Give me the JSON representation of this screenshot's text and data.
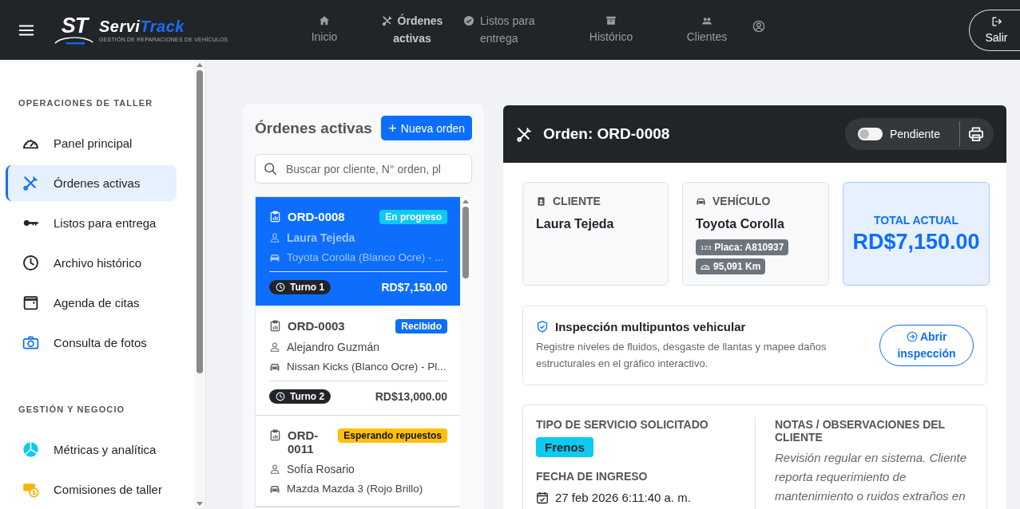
{
  "top_bar": {
    "logo": {
      "mark": "ST",
      "name_start": "Servi",
      "name_end": "Track",
      "tagline": "GESTIÓN DE REPARACIONES DE VEHÍCULOS"
    },
    "nav": [
      {
        "label": "Inicio",
        "selected": false
      },
      {
        "label": "Órdenes activas",
        "selected": true
      },
      {
        "label": "Listos para entrega",
        "selected": false
      },
      {
        "label": "Histórico",
        "selected": false
      },
      {
        "label": "Clientes",
        "selected": false
      }
    ],
    "logout_button": {
      "label": "Salir"
    }
  },
  "sidebar": {
    "sections": [
      {
        "title": "OPERACIONES DE TALLER",
        "items": [
          {
            "label": "Panel principal",
            "selected": false
          },
          {
            "label": "Órdenes activas",
            "selected": true
          },
          {
            "label": "Listos para entrega",
            "selected": false
          },
          {
            "label": "Archivo histórico",
            "selected": false
          },
          {
            "label": "Agenda de citas",
            "selected": false
          },
          {
            "label": "Consulta de fotos",
            "selected": false
          }
        ]
      },
      {
        "title": "GESTIÓN Y NEGOCIO",
        "items": [
          {
            "label": "Métricas y analítica",
            "selected": false
          },
          {
            "label": "Comisiones de taller",
            "selected": false
          }
        ]
      }
    ]
  },
  "orders_panel": {
    "title": "Órdenes activas",
    "new_button": {
      "icon": "+",
      "label": "Nueva orden"
    },
    "search": {
      "placeholder": "Buscar por cliente, N° orden, pl"
    },
    "orders": [
      {
        "number": "ORD-0008",
        "status": "En progreso",
        "color": "#0dcaf0",
        "client": "Laura Tejeda",
        "vehicle": "Toyota Corolla (Blanco Ocre) - ...",
        "turn": "Turno 1",
        "total": "RD$7,150.00",
        "selected": true
      },
      {
        "number": "ORD-0003",
        "status": "Recibido",
        "color": "#0d6efd",
        "client": "Alejandro Guzmán",
        "vehicle": "Nissan Kicks (Blanco Ocre) - Pl...",
        "turn": "Turno 2",
        "total": "RD$13,000.00",
        "selected": false
      },
      {
        "number": "ORD-0011",
        "status": "Esperando repuestos",
        "color": "#ffc107",
        "client": "Sofía Rosario",
        "vehicle": "Mazda Mazda 3 (Rojo Brillo)",
        "selected": false
      }
    ]
  },
  "detail": {
    "title": "Orden: ORD-0008",
    "status_toggle": {
      "label": "Pendiente",
      "on": false
    },
    "client_card": {
      "heading": "CLIENTE",
      "name": "Laura Tejeda"
    },
    "vehicle_card": {
      "heading": "VEHÍCULO",
      "name": "Toyota Corolla",
      "plate_prefix": "123",
      "plate": "Placa: A810937",
      "mileage": "95,091 Km"
    },
    "total_card": {
      "heading": "TOTAL ACTUAL",
      "amount": "RD$7,150.00"
    },
    "inspection": {
      "title": "Inspección multipuntos vehicular",
      "text": "Registre niveles de fluidos, desgaste de llantas y mapee daños estructurales en el gráfico interactivo.",
      "button": "Abrir inspección"
    },
    "service": {
      "type_heading": "TIPO DE SERVICIO SOLICITADO",
      "type": "Frenos",
      "date_heading": "FECHA DE INGRESO",
      "date": "27 feb 2026 6:11:40 a. m.",
      "notes_heading": "NOTAS / OBSERVACIONES DEL CLIENTE",
      "notes": "Revisión regular en sistema. Cliente reporta requerimiento de mantenimiento o ruidos extraños en"
    }
  }
}
